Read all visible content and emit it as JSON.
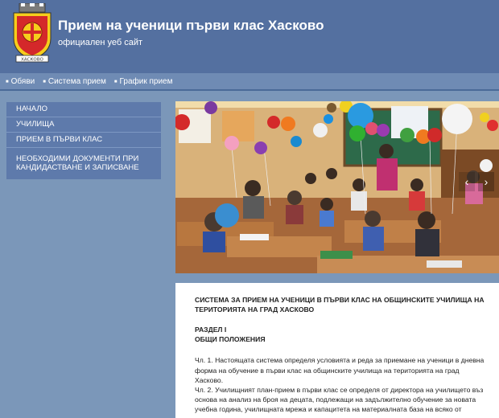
{
  "header": {
    "title": "Прием на ученици първи клас Хасково",
    "subtitle": "официален уеб сайт",
    "crest_text": "ХАСКОВО"
  },
  "topnav": {
    "items": [
      "Обяви",
      "Система прием",
      "График прием"
    ]
  },
  "sidemenu": {
    "items": [
      "НАЧАЛО",
      "УЧИЛИЩА",
      "ПРИЕМ В ПЪРВИ КЛАС",
      "НЕОБХОДИМИ ДОКУМЕНТИ ПРИ КАНДИДАСТВАНЕ И ЗАПИСВАНЕ"
    ]
  },
  "slider": {
    "prev_icon": "‹",
    "next_icon": "›"
  },
  "content": {
    "heading": "СИСТЕМА ЗА ПРИЕМ НА УЧЕНИЦИ В ПЪРВИ КЛАС НА ОБЩИНСКИТЕ УЧИЛИЩА НА ТЕРИТОРИЯТА НА ГРАД ХАСКОВО",
    "section_title": "РАЗДЕЛ I",
    "section_subtitle": "ОБЩИ ПОЛОЖЕНИЯ",
    "paragraphs": [
      "Чл. 1. Настоящата система определя условията и реда за приемане на ученици в дневна форма на обучение в първи клас на общинските училища на територията на град Хасково.",
      "Чл. 2. Училищният план-прием в първи клас се определя от директора на училището въз основа на анализ на броя на децата, подлежащи на задължително обучение за новата учебна година, училищната мрежа и капацитета на материалната база на всяко от"
    ]
  },
  "colors": {
    "header_bg": "#5470a0",
    "page_bg": "#7b97b9",
    "menu_bg": "#5e7aab",
    "crest_red": "#d4282a",
    "crest_yellow": "#f6cd1c"
  }
}
